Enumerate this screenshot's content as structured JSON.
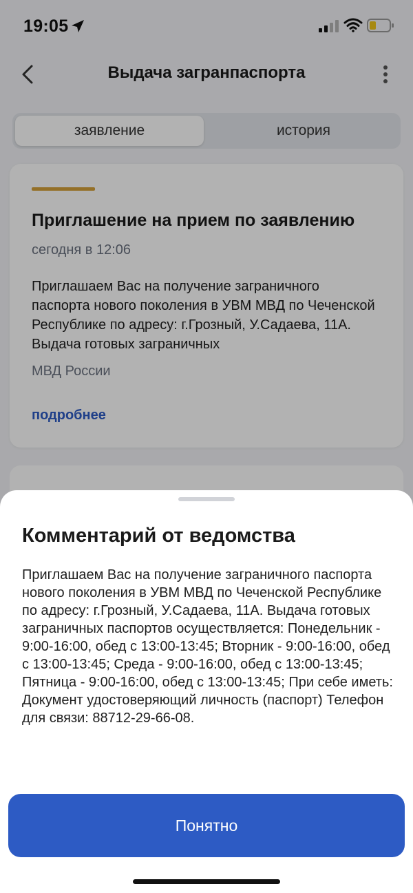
{
  "status_bar": {
    "time": "19:05",
    "icons": [
      "location-arrow-icon",
      "cellular-signal-icon",
      "wifi-icon",
      "battery-low-icon"
    ]
  },
  "header": {
    "title": "Выдача загранпаспорта",
    "back_icon": "chevron-left-icon",
    "menu_icon": "more-vertical-icon"
  },
  "tabs": [
    {
      "label": "заявление",
      "active": true
    },
    {
      "label": "история",
      "active": false
    }
  ],
  "card": {
    "accent_color": "#d4a13a",
    "title": "Приглашение на прием по заявлению",
    "date": "сегодня в 12:06",
    "text": "Приглашаем Вас на получение заграничного паспорта нового поколения в УВМ МВД по Чеченской Республике по адресу: г.Грозный, У.Садаева, 11А. Выдача готовых заграничных",
    "source": "МВД России",
    "link_label": "подробнее"
  },
  "sheet": {
    "title": "Комментарий от ведомства",
    "text": "Приглашаем Вас на получение заграничного паспорта нового поколения в УВМ МВД по Чеченской Республике по адресу: г.Грозный, У.Садаева, 11А. Выдача готовых заграничных паспортов осуществляется: Понедельник - 9:00-16:00, обед с 13:00-13:45; Вторник - 9:00-16:00, обед с 13:00-13:45; Среда - 9:00-16:00, обед с 13:00-13:45; Пятница - 9:00-16:00, обед с 13:00-13:45; При себе иметь: Документ удостоверяющий личность (паспорт) Телефон для связи: 88712-29-66-08.",
    "button_label": "Понятно"
  },
  "colors": {
    "primary": "#2d5bc4",
    "accent": "#d4a13a"
  }
}
